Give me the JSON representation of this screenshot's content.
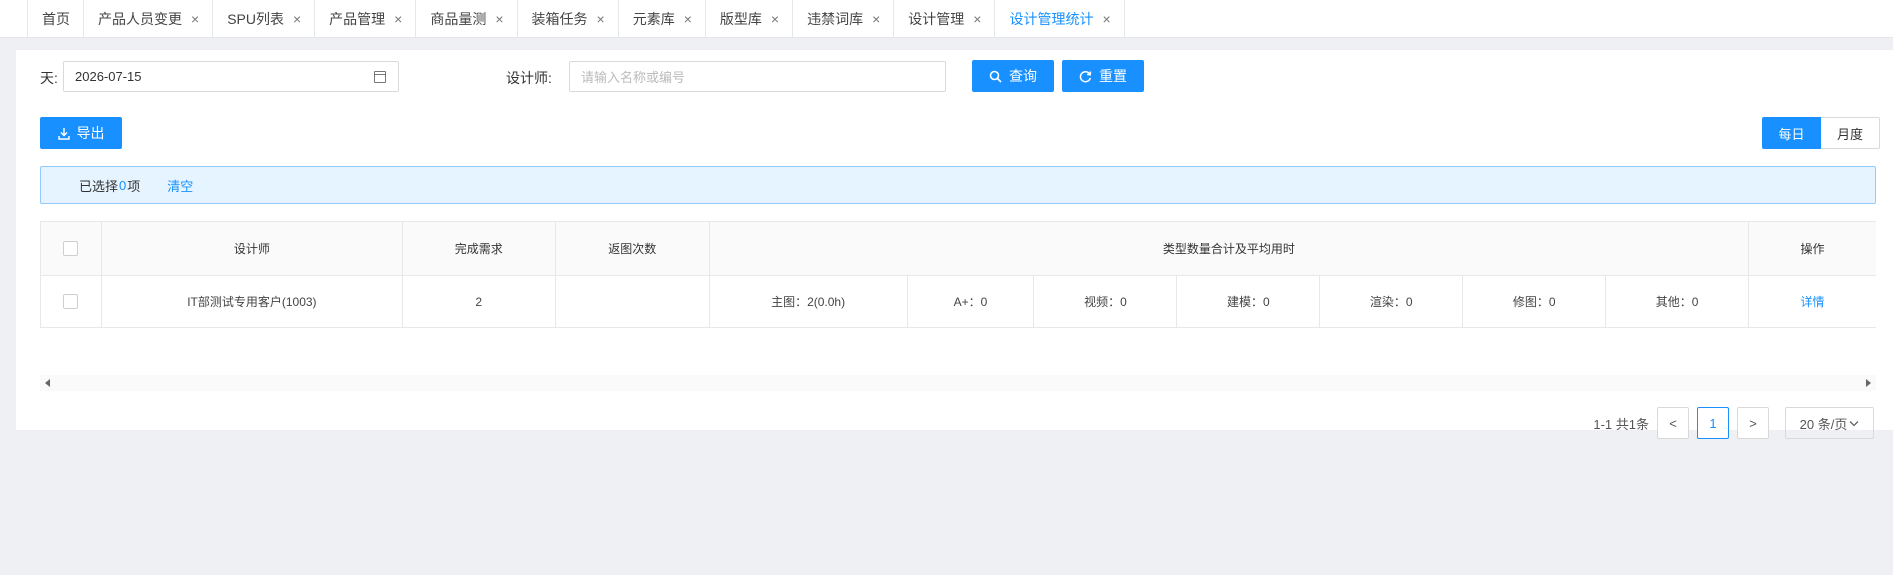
{
  "tabs": [
    {
      "label": "首页",
      "closable": false
    },
    {
      "label": "产品人员变更",
      "closable": true
    },
    {
      "label": "SPU列表",
      "closable": true
    },
    {
      "label": "产品管理",
      "closable": true
    },
    {
      "label": "商品量测",
      "closable": true
    },
    {
      "label": "装箱任务",
      "closable": true
    },
    {
      "label": "元素库",
      "closable": true
    },
    {
      "label": "版型库",
      "closable": true
    },
    {
      "label": "违禁词库",
      "closable": true
    },
    {
      "label": "设计管理",
      "closable": true
    },
    {
      "label": "设计管理统计",
      "closable": true,
      "active": true
    }
  ],
  "close_glyph": "×",
  "filters": {
    "day_label": "天:",
    "day_value": "2026-07-15",
    "designer_label": "设计师:",
    "designer_placeholder": "请输入名称或编号"
  },
  "buttons": {
    "query": "查询",
    "reset": "重置",
    "export": "导出"
  },
  "period_toggle": {
    "daily": "每日",
    "monthly": "月度",
    "selected": "daily"
  },
  "selection": {
    "prefix": "已选择",
    "count": "0",
    "suffix": "项",
    "clear": "清空"
  },
  "table": {
    "headers": {
      "designer": "设计师",
      "completed": "完成需求",
      "returns": "返图次数",
      "types": "类型数量合计及平均用时",
      "actions": "操作"
    },
    "rows": [
      {
        "designer": "IT部测试专用客户(1003)",
        "completed": "2",
        "returns": "",
        "type_cells": [
          "主图：2(0.0h)",
          "A+：0",
          "视频：0",
          "建模：0",
          "渲染：0",
          "修图：0",
          "其他：0"
        ],
        "action": "详情"
      }
    ]
  },
  "pagination": {
    "summary": "1-1 共1条",
    "current_page": "1",
    "page_size": "20 条/页",
    "prev_glyph": "<",
    "next_glyph": ">"
  },
  "colors": {
    "primary": "#1890ff",
    "alert_bg": "#e6f4ff",
    "page_bg": "#eef0f3"
  }
}
